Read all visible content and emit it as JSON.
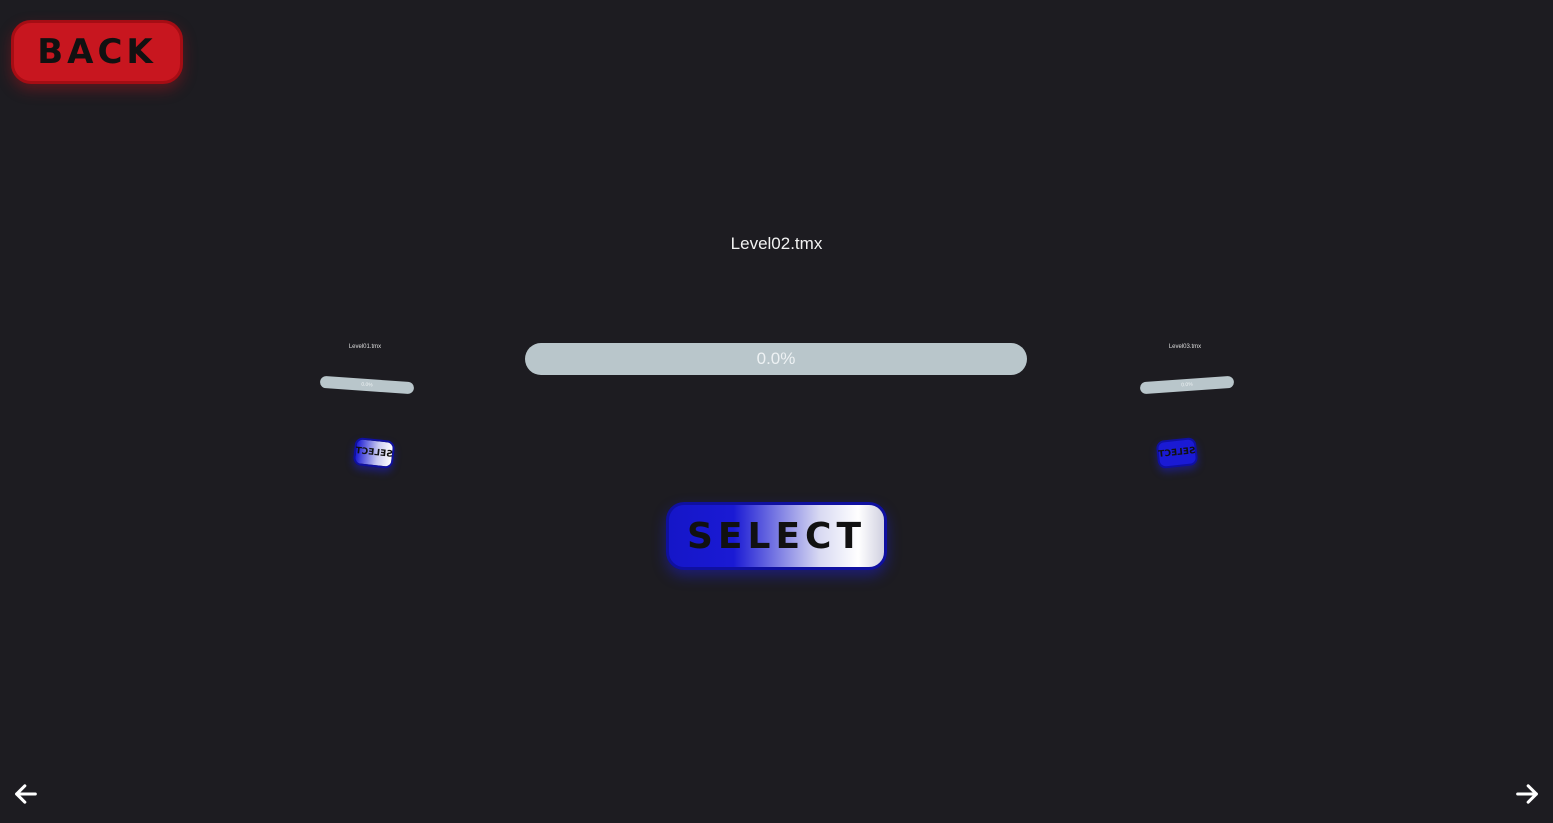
{
  "header": {
    "back_label": "BACK"
  },
  "level": {
    "filename": "Level02.tmx",
    "progress_text": "0.0%",
    "progress_value": 0.0
  },
  "actions": {
    "select_label": "SELECT"
  },
  "carousel": {
    "left_preview": {
      "filename": "Level01.tmx",
      "progress_text": "0.0%",
      "select_label": "SELECT"
    },
    "right_preview": {
      "filename": "Level03.tmx",
      "progress_text": "0.0%",
      "select_label": "SELECT"
    }
  },
  "navigation": {
    "prev_icon": "arrow-left-icon",
    "next_icon": "arrow-right-icon"
  },
  "colors": {
    "background": "#1d1c21",
    "back_button": "#c8161f",
    "select_button": "#1a1ad4",
    "progress_track": "#b9c6cb",
    "text": "#f2f2f2"
  }
}
